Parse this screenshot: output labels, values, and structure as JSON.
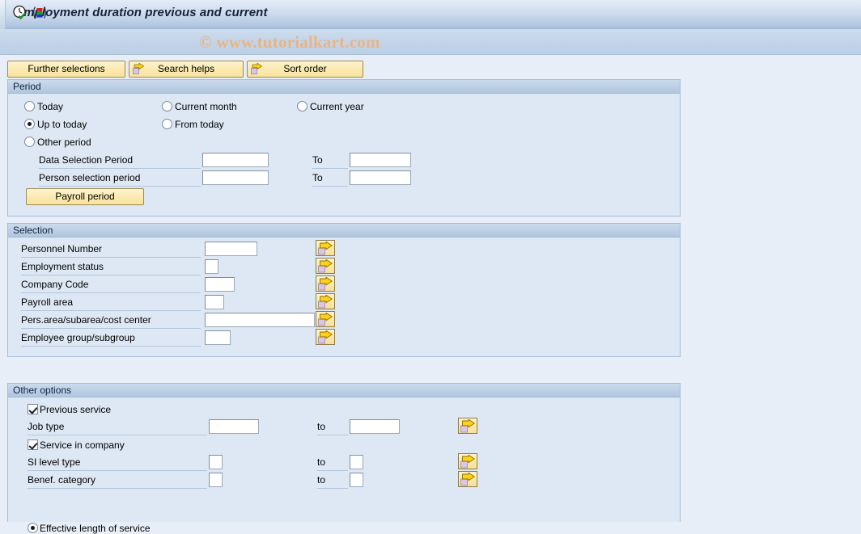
{
  "window": {
    "title": "Employment duration previous and current",
    "watermark": "© www.tutorialkart.com"
  },
  "toolbar": {
    "icons": [
      {
        "name": "execute-clock-icon",
        "title": "Execute"
      },
      {
        "name": "variant-icon",
        "title": "Get Variant"
      }
    ]
  },
  "action_buttons": [
    {
      "label": "Further selections",
      "icon": null
    },
    {
      "label": "Search helps",
      "icon": "arrow-right-icon"
    },
    {
      "label": "Sort order",
      "icon": "arrow-right-icon"
    }
  ],
  "period": {
    "title": "Period",
    "radios": [
      {
        "label": "Today",
        "selected": false
      },
      {
        "label": "Current month",
        "selected": false
      },
      {
        "label": "Current year",
        "selected": false
      },
      {
        "label": "Up to today",
        "selected": true
      },
      {
        "label": "From today",
        "selected": false
      },
      {
        "label": "Other period",
        "selected": false
      }
    ],
    "rows": [
      {
        "label": "Data Selection Period",
        "value": "",
        "to_label": "To",
        "to_value": ""
      },
      {
        "label": "Person selection period",
        "value": "",
        "to_label": "To",
        "to_value": ""
      }
    ],
    "payroll_button": "Payroll period"
  },
  "selection": {
    "title": "Selection",
    "rows": [
      {
        "label": "Personnel Number",
        "value": ""
      },
      {
        "label": "Employment status",
        "value": ""
      },
      {
        "label": "Company Code",
        "value": ""
      },
      {
        "label": "Payroll area",
        "value": ""
      },
      {
        "label": "Pers.area/subarea/cost center",
        "value": ""
      },
      {
        "label": "Employee group/subgroup",
        "value": ""
      }
    ]
  },
  "other_options": {
    "title": "Other options",
    "checkboxes": [
      {
        "label": "Previous service",
        "checked": true
      },
      {
        "label": "Service in company",
        "checked": true
      }
    ],
    "rows": [
      {
        "label": "Job type",
        "value": "",
        "to_label": "to",
        "to_value": ""
      },
      {
        "label": "SI level type",
        "value": "",
        "to_label": "to",
        "to_value": ""
      },
      {
        "label": "Benef. category",
        "value": "",
        "to_label": "to",
        "to_value": ""
      }
    ],
    "bottom_radio": {
      "label": "Effective length of service",
      "selected": true
    }
  },
  "colors": {
    "button_yellow": "#fbeab0",
    "panel_bg": "#dde8f4",
    "page_bg": "#e8eef7",
    "watermark": "#e8b483"
  }
}
